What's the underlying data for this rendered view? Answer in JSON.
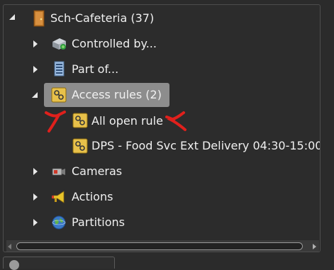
{
  "tree": {
    "root": {
      "label": "Sch-Cafeteria (37)",
      "icon": "door-icon",
      "expanded": true
    },
    "children": [
      {
        "label": "Controlled by...",
        "icon": "server-icon",
        "expanded": false
      },
      {
        "label": "Part of...",
        "icon": "building-icon",
        "expanded": false
      },
      {
        "label": "Access rules (2)",
        "icon": "access-rule-icon",
        "expanded": true,
        "selected": true,
        "children": [
          {
            "label": "All open rule",
            "icon": "access-rule-icon"
          },
          {
            "label": "DPS - Food Svc Ext Delivery 04:30-15:00",
            "icon": "access-rule-icon"
          }
        ]
      },
      {
        "label": "Cameras",
        "icon": "camera-icon",
        "expanded": false
      },
      {
        "label": "Actions",
        "icon": "megaphone-icon",
        "expanded": false
      },
      {
        "label": "Partitions",
        "icon": "globe-icon",
        "expanded": false
      }
    ]
  },
  "annotations": {
    "color": "#e0201c"
  },
  "colors": {
    "selected_bg": "#8d8d8d",
    "text": "#f0f0f0",
    "panel_bg": "#2c2c2c"
  }
}
